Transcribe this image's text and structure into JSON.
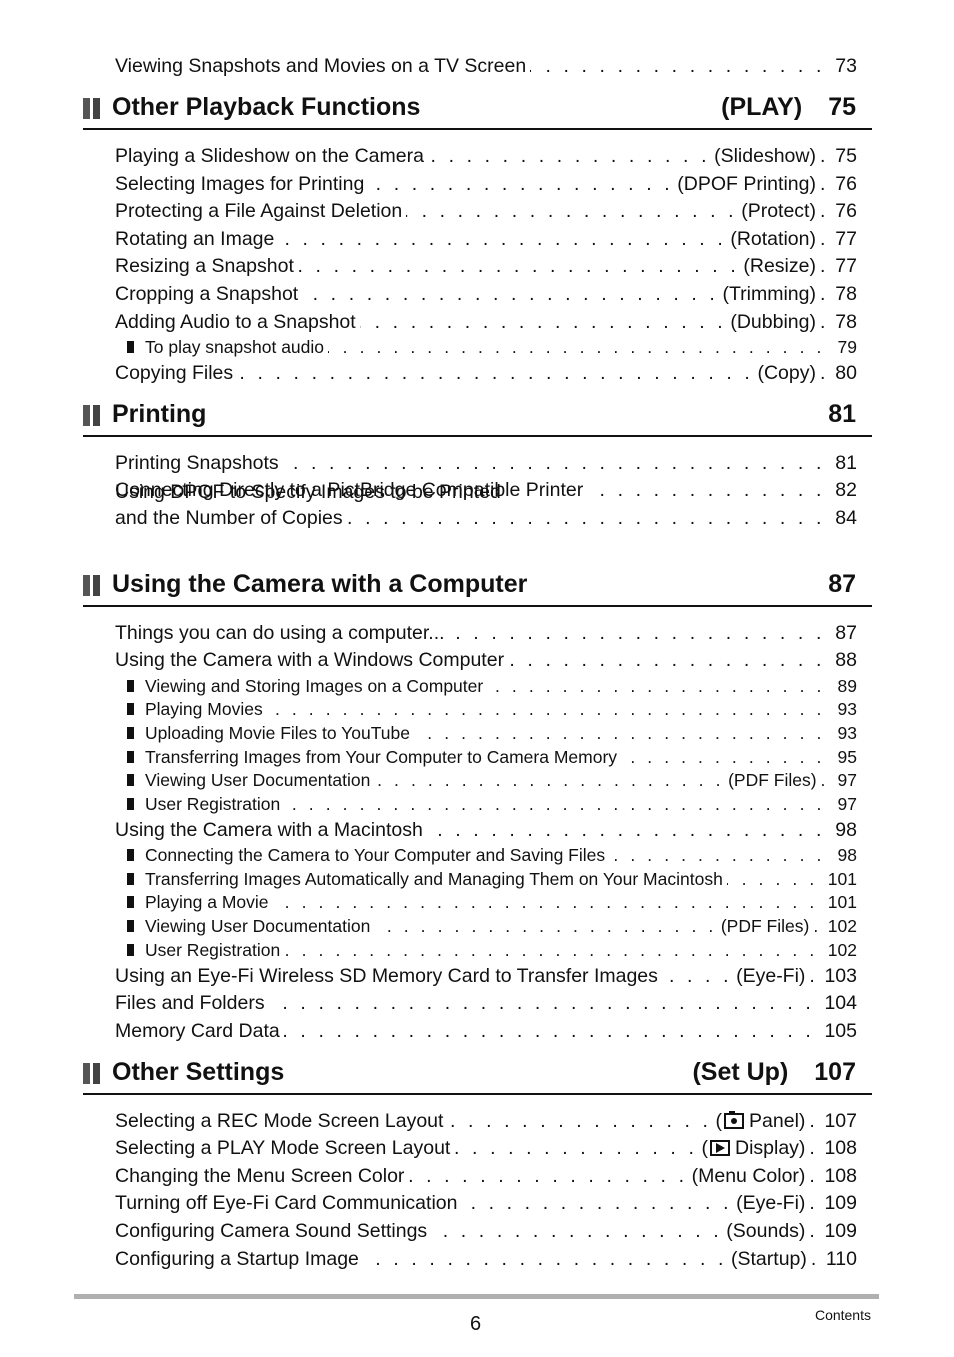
{
  "top_entry": {
    "title": "Viewing Snapshots and Movies on a TV Screen",
    "paren": "",
    "page": "73"
  },
  "sections": [
    {
      "title": "Other Playback Functions",
      "tag": "(PLAY)",
      "page": "75",
      "entries": [
        {
          "title": "Playing a Slideshow on the Camera",
          "paren": "(Slideshow)",
          "page": "75"
        },
        {
          "title": "Selecting Images for Printing",
          "paren": "(DPOF Printing)",
          "page": "76"
        },
        {
          "title": "Protecting a File Against Deletion",
          "paren": "(Protect)",
          "page": "76"
        },
        {
          "title": "Rotating an Image",
          "paren": "(Rotation)",
          "page": "77"
        },
        {
          "title": "Resizing a Snapshot",
          "paren": "(Resize)",
          "page": "77"
        },
        {
          "title": "Cropping a Snapshot",
          "paren": "(Trimming)",
          "page": "78"
        },
        {
          "title": "Adding Audio to a Snapshot",
          "paren": "(Dubbing)",
          "page": "78"
        },
        {
          "title": "To play snapshot audio",
          "paren": "",
          "page": "79",
          "sub": true
        },
        {
          "title": "Copying Files",
          "paren": "(Copy)",
          "page": "80"
        }
      ]
    },
    {
      "title": "Printing",
      "tag": "",
      "page": "81",
      "entries": [
        {
          "title": "Printing Snapshots",
          "paren": "",
          "page": "81"
        },
        {
          "title": "Connecting Directly to a PictBridge Compatible Printer",
          "paren": "",
          "page": "82"
        },
        {
          "title": "Using DPOF to Specify Images to be Printed",
          "title_line2": "and the Number of Copies",
          "paren": "",
          "page": "84"
        }
      ]
    },
    {
      "title": "Using the Camera with a Computer",
      "tag": "",
      "page": "87",
      "entries": [
        {
          "title": "Things you can do using a computer...",
          "paren": "",
          "page": "87"
        },
        {
          "title": "Using the Camera with a Windows Computer",
          "paren": "",
          "page": "88"
        },
        {
          "title": "Viewing and Storing Images on a Computer",
          "paren": "",
          "page": "89",
          "sub": true
        },
        {
          "title": "Playing Movies",
          "paren": "",
          "page": "93",
          "sub": true
        },
        {
          "title": "Uploading Movie Files to YouTube",
          "paren": "",
          "page": "93",
          "sub": true
        },
        {
          "title": "Transferring Images from Your Computer to Camera Memory",
          "paren": "",
          "page": "95",
          "sub": true
        },
        {
          "title": "Viewing User Documentation",
          "paren": "(PDF Files)",
          "page": "97",
          "sub": true
        },
        {
          "title": "User Registration",
          "paren": "",
          "page": "97",
          "sub": true
        },
        {
          "title": "Using the Camera with a Macintosh",
          "paren": "",
          "page": "98"
        },
        {
          "title": "Connecting the Camera to Your Computer and Saving Files",
          "paren": "",
          "page": "98",
          "sub": true
        },
        {
          "title": "Transferring Images Automatically and Managing Them on Your Macintosh",
          "paren": "",
          "page": "101",
          "sub": true
        },
        {
          "title": "Playing a Movie",
          "paren": "",
          "page": "101",
          "sub": true
        },
        {
          "title": "Viewing User Documentation",
          "paren": "(PDF Files)",
          "page": "102",
          "sub": true
        },
        {
          "title": "User Registration",
          "paren": "",
          "page": "102",
          "sub": true
        },
        {
          "title": "Using an Eye-Fi Wireless SD Memory Card to Transfer Images",
          "paren": "(Eye-Fi)",
          "page": "103"
        },
        {
          "title": "Files and Folders",
          "paren": "",
          "page": "104"
        },
        {
          "title": "Memory Card Data",
          "paren": "",
          "page": "105"
        }
      ]
    },
    {
      "title": "Other Settings",
      "tag": "(Set Up)",
      "page": "107",
      "entries": [
        {
          "title": "Selecting a REC Mode Screen Layout",
          "paren": "Panel)",
          "paren_icon": "camera-icon",
          "page": "107"
        },
        {
          "title": "Selecting a PLAY Mode Screen Layout",
          "paren": "Display)",
          "paren_icon": "play-icon",
          "page": "108"
        },
        {
          "title": "Changing the Menu Screen Color",
          "paren": "(Menu Color)",
          "page": "108"
        },
        {
          "title": "Turning off Eye-Fi Card Communication",
          "paren": "(Eye-Fi)",
          "page": "109"
        },
        {
          "title": "Configuring Camera Sound Settings",
          "paren": "(Sounds)",
          "page": "109"
        },
        {
          "title": "Configuring a Startup Image",
          "paren": "(Startup)",
          "page": "110"
        }
      ]
    }
  ],
  "footer": {
    "page_number": "6",
    "label": "Contents"
  },
  "leader_dots": ". . . . . . . . . . . . . . . . . . . . . . . . . . . . . . . . . . . . . . . . . . . . . . . . . . . . . . . . . . . . . . . . . . . . . . . . . . . ."
}
